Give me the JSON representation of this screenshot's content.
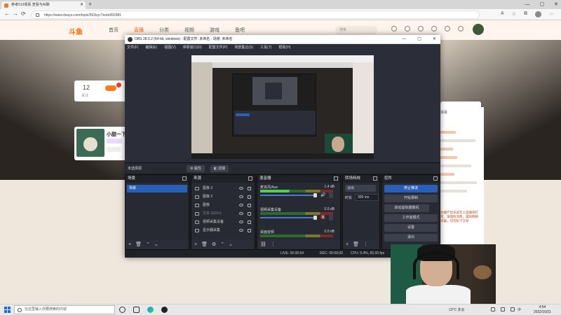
{
  "browser": {
    "tab_title": "参考513观看 查看与AI聊",
    "url": "https://www.douyu.com/topic/553sycTnote992981",
    "nav": {
      "back": "←",
      "forward": "→",
      "reload": "⟳",
      "new_tab": "+"
    },
    "win": {
      "min": "—",
      "max": "▢",
      "close": "✕"
    },
    "tab_close": "✕",
    "toolbar_glyphs": [
      "A",
      "☆",
      "⧉",
      "⋯"
    ]
  },
  "site": {
    "logo": "斗鱼",
    "nav": [
      "首页",
      "直播",
      "分类",
      "视频",
      "游戏",
      "鱼吧"
    ],
    "search_placeholder": "搜索",
    "follow_count": "12",
    "follow_label": "关注",
    "anchor_name": "小甜一下",
    "chat_title": "弹幕",
    "chat_text": "主播严禁未成年人直播或打赏，请理性消费，谨防网络诈骗，切勿私下交易"
  },
  "obs": {
    "title": "OBS 28.0.2 (64-bit, windows) - 配置文件: 未命名 - 场景: 未命名",
    "window_controls": [
      "—",
      "▢",
      "✕"
    ],
    "menu": [
      "文件(F)",
      "编辑(E)",
      "视图(V)",
      "停靠窗口(D)",
      "配置文件(P)",
      "场景集合(S)",
      "工具(T)",
      "帮助(H)"
    ],
    "source_bar": {
      "label": "未选择源",
      "properties": "⚙ 属性",
      "filters": "◧ 滤镜"
    },
    "docks": {
      "scenes": {
        "title": "场景",
        "items": [
          "场景"
        ]
      },
      "sources": {
        "title": "来源",
        "items": [
          {
            "name": "图像 3",
            "dim": false
          },
          {
            "name": "图像 2",
            "dim": false
          },
          {
            "name": "图像",
            "dim": false
          },
          {
            "name": "文本 (GDI+)",
            "dim": true
          },
          {
            "name": "视频采集设备",
            "dim": false
          },
          {
            "name": "显示器采集",
            "dim": false
          }
        ]
      },
      "mixer": {
        "title": "混音器",
        "channels": [
          {
            "name": "麦克风/Aux",
            "db": "1.4 dB",
            "active": true,
            "muted": false
          },
          {
            "name": "视频采集设备",
            "db": "0.0 dB",
            "active": false,
            "muted": true
          },
          {
            "name": "桌面音频",
            "db": "0.0 dB",
            "active": false,
            "muted": true
          }
        ]
      },
      "transitions": {
        "title": "转场特效",
        "selected": "淡出",
        "duration_label": "时长",
        "duration": "300 ms"
      },
      "controls": {
        "title": "控件",
        "buttons": [
          "停止推流",
          "开始录制",
          "启动虚拟摄像机",
          "工作室模式",
          "设置",
          "退出"
        ]
      }
    },
    "footer_glyphs": {
      "add": "+",
      "remove": "🗑",
      "up": "⌃",
      "down": "⌄",
      "settings": "⚙",
      "more": "⋮",
      "link": "⛓",
      "vol_on": "🔊",
      "vol_mute": "🔇",
      "chev": "⌄"
    },
    "status": {
      "live": "LIVE: 00:00:54",
      "rec": "REC: 00:00:00",
      "cpu": "CPU: 5.4%, 60.00 fps"
    }
  },
  "taskbar": {
    "search_placeholder": "在这里输入你要搜索的内容",
    "weather": "13°C 多云",
    "ime": "中",
    "time": "4:54",
    "date": "2022/10/21"
  },
  "colors": {
    "accent": "#2a5fb8",
    "brand": "#ff6a00",
    "muted": "#e44444"
  }
}
